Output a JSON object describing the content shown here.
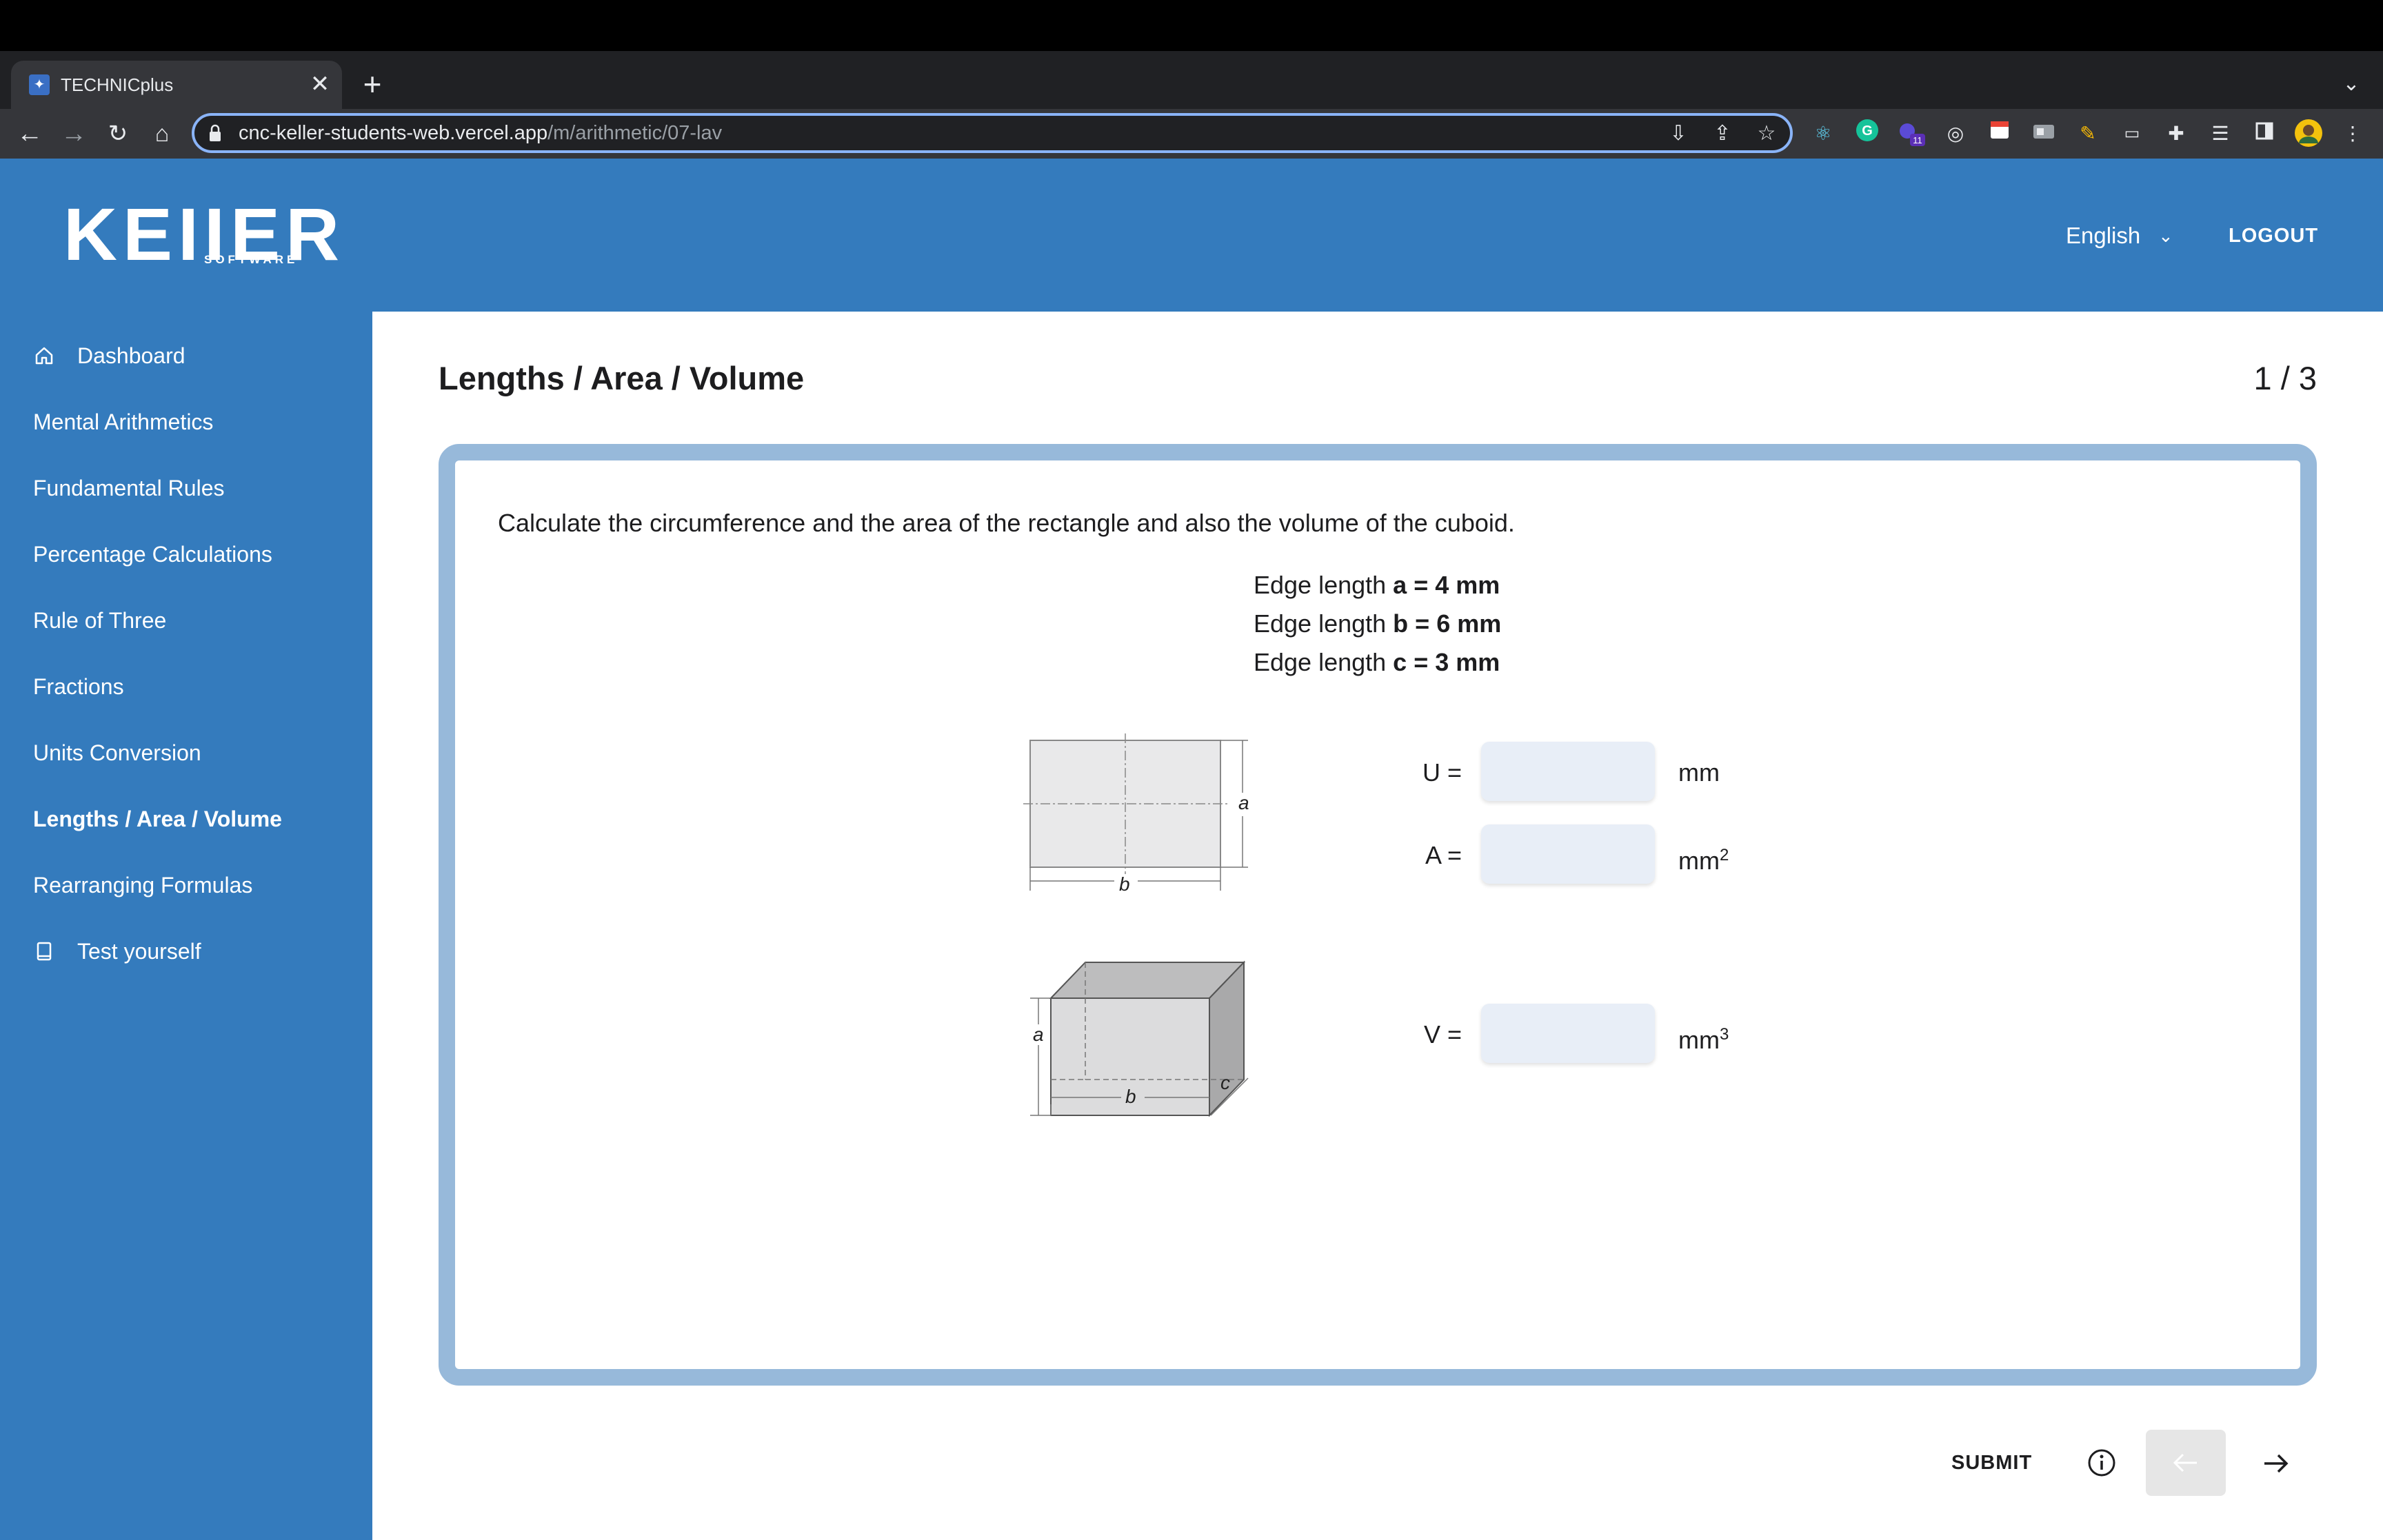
{
  "browser": {
    "tab_title": "TECHNICplus",
    "tab_close": "✕",
    "new_tab": "+",
    "url_host": "cnc-keller-students-web.vercel.app",
    "url_path": "/m/arithmetic/07-lav",
    "extension_badge": "11"
  },
  "header": {
    "logo_text": "KEIIER",
    "logo_sub": "SOFTWARE",
    "language": "English",
    "logout": "LOGOUT"
  },
  "sidebar": {
    "items": [
      {
        "label": "Dashboard",
        "icon": "home-icon"
      },
      {
        "label": "Mental Arithmetics"
      },
      {
        "label": "Fundamental Rules"
      },
      {
        "label": "Percentage Calculations"
      },
      {
        "label": "Rule of Three"
      },
      {
        "label": "Fractions"
      },
      {
        "label": "Units Conversion"
      },
      {
        "label": "Lengths / Area / Volume",
        "active": true
      },
      {
        "label": "Rearranging Formulas"
      },
      {
        "label": "Test yourself",
        "icon": "book-icon"
      }
    ]
  },
  "main": {
    "title": "Lengths / Area / Volume",
    "page_count": "1 / 3",
    "question": "Calculate the circumference and the area of the rectangle and also the volume of the cuboid.",
    "edges": [
      {
        "prefix": "Edge length ",
        "value": "a = 4 mm"
      },
      {
        "prefix": "Edge length ",
        "value": "b = 6 mm"
      },
      {
        "prefix": "Edge length ",
        "value": "c = 3 mm"
      }
    ],
    "figure_labels": {
      "a": "a",
      "b": "b",
      "c": "c"
    },
    "answers": [
      {
        "label": "U =",
        "value": "",
        "unit": "mm",
        "sup": ""
      },
      {
        "label": "A =",
        "value": "",
        "unit": "mm",
        "sup": "2"
      },
      {
        "label": "V =",
        "value": "",
        "unit": "mm",
        "sup": "3"
      }
    ]
  },
  "footer": {
    "submit": "SUBMIT"
  },
  "colors": {
    "brand_blue": "#347bbd",
    "card_border": "#97b9da",
    "input_bg": "#e8eef7",
    "chrome_dark": "#202124"
  }
}
